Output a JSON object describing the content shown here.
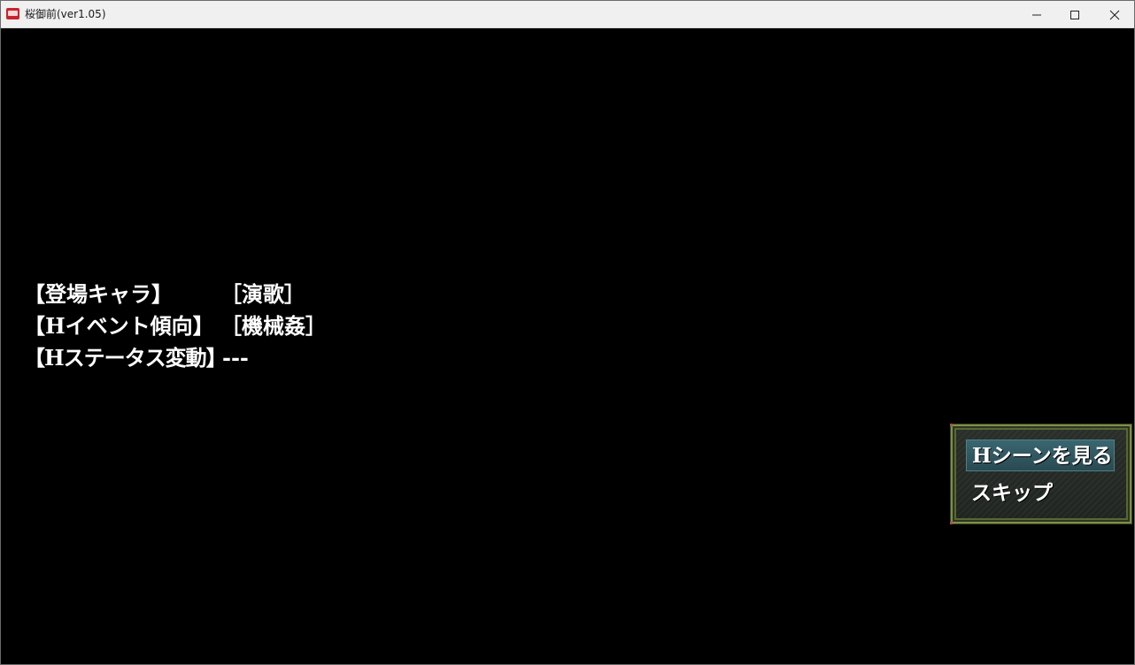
{
  "window": {
    "title": "桜御前(ver1.05)",
    "icon": "app-icon"
  },
  "controls": {
    "minimize_icon": "minimize-icon",
    "maximize_icon": "maximize-icon",
    "close_icon": "close-icon"
  },
  "info": {
    "rows": [
      {
        "label": "【登場キャラ】",
        "value": "［演歌］"
      },
      {
        "label": "【Hイベント傾向】",
        "value": "［機械姦］"
      },
      {
        "label": "【Hステータス変動】",
        "value": "---"
      }
    ]
  },
  "menu": {
    "items": [
      {
        "label": "Hシーンを見る",
        "selected": true
      },
      {
        "label": "スキップ",
        "selected": false
      }
    ],
    "frame_color": "#7d8f4a",
    "highlight_color": "#3a6670"
  }
}
